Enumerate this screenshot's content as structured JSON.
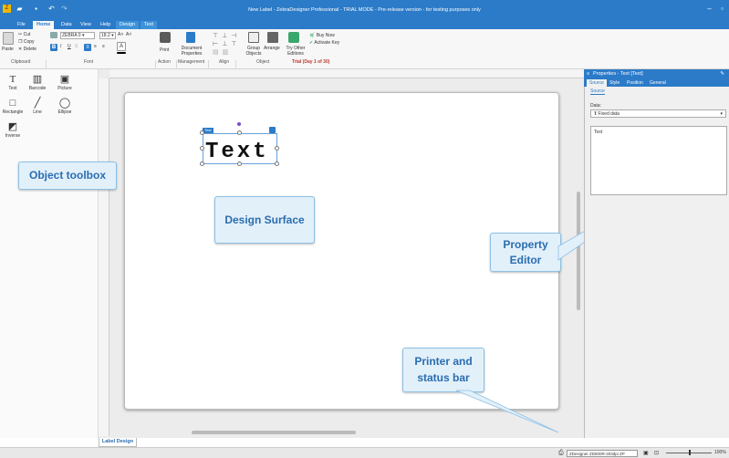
{
  "window": {
    "title": "New Label - ZebraDesigner Professional - TRIAL MODE - Pre-release version - for testing purposes only"
  },
  "tabs": [
    {
      "label": "File"
    },
    {
      "label": "Home"
    },
    {
      "label": "Data"
    },
    {
      "label": "View"
    },
    {
      "label": "Help"
    },
    {
      "label": "Design"
    },
    {
      "label": "Text"
    }
  ],
  "ribbon": {
    "clipboard": {
      "paste": "Paste",
      "cut": "Cut",
      "copy": "Copy",
      "delete": "Delete",
      "group": "Clipboard"
    },
    "font": {
      "name": "ZEBRA 0",
      "size": "18.2",
      "group": "Font"
    },
    "action": {
      "print": "Print",
      "group": "Action"
    },
    "management": {
      "doc_props": "Document Properties",
      "group": "Management"
    },
    "align": {
      "group": "Align"
    },
    "object": {
      "group_objects": "Group Objects",
      "arrange": "Arrange",
      "try_other": "Try Other Editions",
      "buy_now": "Buy Now",
      "activate": "Activate Key",
      "group": "Object",
      "trial": "Trial (Day 1 of 30)"
    }
  },
  "toolbox": {
    "items": [
      {
        "label": "Text",
        "icon": "T"
      },
      {
        "label": "Barcode",
        "icon": "▥"
      },
      {
        "label": "Picture",
        "icon": "▣"
      },
      {
        "label": "Rectangle",
        "icon": "□"
      },
      {
        "label": "Line",
        "icon": "╱"
      },
      {
        "label": "Ellipse",
        "icon": "◯"
      },
      {
        "label": "Inverse",
        "icon": "◩"
      }
    ]
  },
  "canvas": {
    "text_object": "Text",
    "text_tag": "Text",
    "doc_tab": "Label Design"
  },
  "callouts": {
    "toolbox": "Object toolbox",
    "design": "Design Surface",
    "property": "Property Editor",
    "printer": "Printer and status bar"
  },
  "properties": {
    "header": "Properties - Text [Text]",
    "tabs": [
      "Source",
      "Style",
      "Position",
      "General"
    ],
    "subtab": "Source",
    "data_label": "Data:",
    "data_value": "Fixed data",
    "text_value": "Text"
  },
  "statusbar": {
    "printer": "ZDesigner ZD500R-203dpi ZP",
    "zoom": "100%"
  },
  "colors": {
    "accent": "#2c7bc8",
    "callout_bg": "#e2f0fa",
    "trial": "#c0392b"
  }
}
